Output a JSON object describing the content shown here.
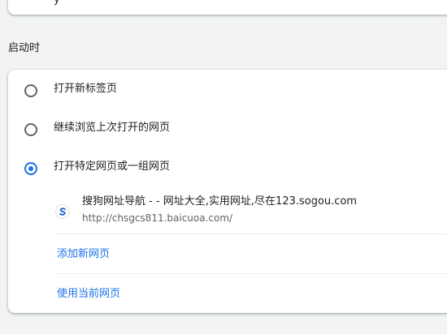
{
  "top_card": {
    "clipped_text": "ý"
  },
  "startup": {
    "section_title": "启动时",
    "options": [
      {
        "label": "打开新标签页",
        "selected": false
      },
      {
        "label": "继续浏览上次打开的网页",
        "selected": false
      },
      {
        "label": "打开特定网页或一组网页",
        "selected": true
      }
    ],
    "pages": [
      {
        "title": "搜狗网址导航 - - 网址大全,实用网址,尽在123.sogou.com",
        "url": "http://chsgcs811.baicuoa.com/",
        "icon": "sogou-favicon-icon"
      }
    ],
    "add_page_label": "添加新网页",
    "use_current_label": "使用当前网页"
  },
  "colors": {
    "accent": "#1a73e8",
    "radio_unchecked": "#5f6368",
    "text_primary": "#202124",
    "text_secondary": "#5f6368",
    "background": "#f1f3f4"
  }
}
